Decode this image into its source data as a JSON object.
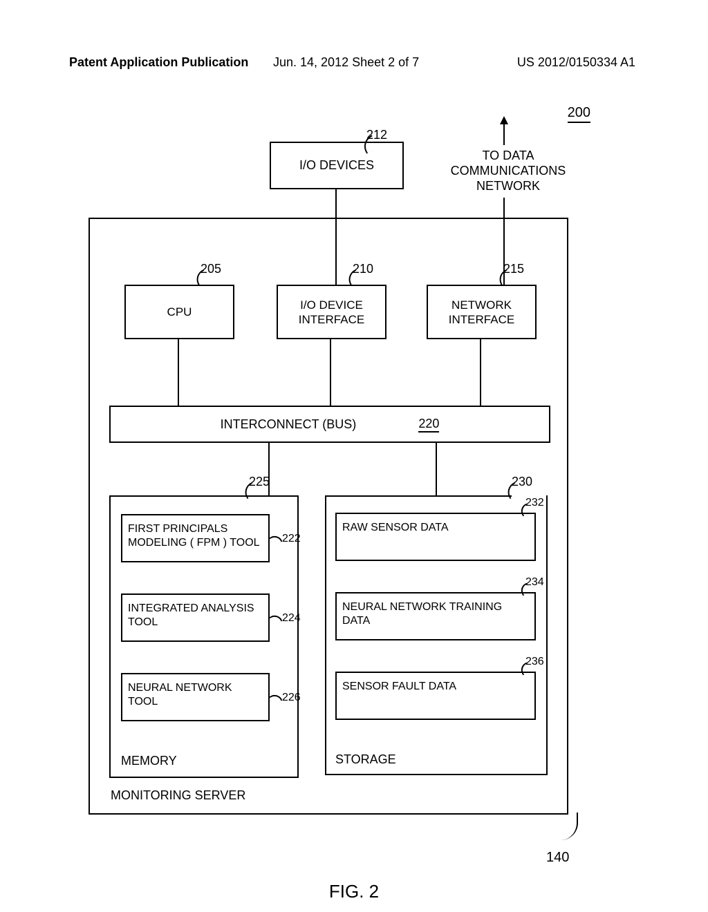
{
  "header": {
    "left": "Patent Application Publication",
    "center": "Jun. 14, 2012  Sheet 2 of 7",
    "right": "US 2012/0150334 A1"
  },
  "figure_label": "FIG. 2",
  "refs": {
    "r200": "200",
    "r212": "212",
    "r205": "205",
    "r210": "210",
    "r215": "215",
    "r220": "220",
    "r225": "225",
    "r230": "230",
    "r222": "222",
    "r224": "224",
    "r226": "226",
    "r232": "232",
    "r234": "234",
    "r236": "236",
    "r140": "140"
  },
  "labels": {
    "io_devices": "I/O DEVICES",
    "to_net": "TO DATA COMMUNICATIONS NETWORK",
    "cpu": "CPU",
    "io_iface": "I/O DEVICE INTERFACE",
    "net_iface": "NETWORK INTERFACE",
    "bus": "INTERCONNECT   (BUS)",
    "mem_title": "MEMORY",
    "storage_title": "STORAGE",
    "server_title": "MONITORING SERVER",
    "m1": "FIRST PRINCIPALS MODELING ( FPM ) TOOL",
    "m2": "INTEGRATED ANALYSIS TOOL",
    "m3": "NEURAL NETWORK TOOL",
    "s1": "RAW SENSOR DATA",
    "s2": "NEURAL NETWORK TRAINING DATA",
    "s3": "SENSOR FAULT DATA"
  }
}
